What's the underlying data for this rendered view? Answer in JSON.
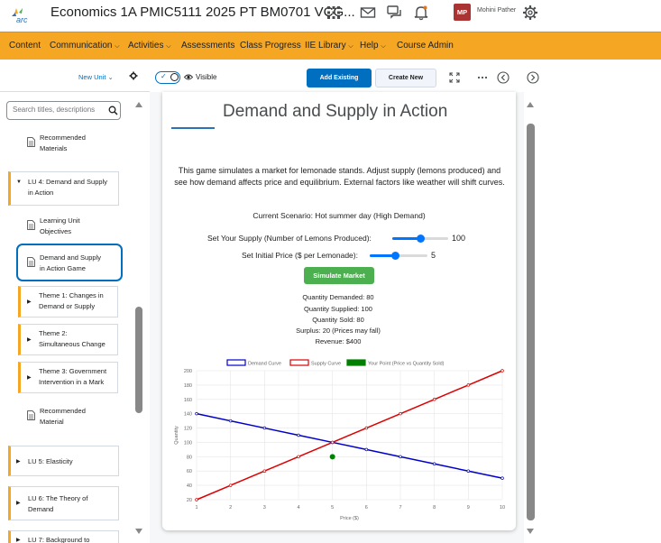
{
  "topbar": {
    "course_title": "Economics 1A PMIC5111 2025 PT BM0701 VCG...",
    "avatar_initials": "MP",
    "user_name": "Mohini Pather"
  },
  "nav": [
    "Content",
    "Communication",
    "Activities",
    "Assessments",
    "Class Progress",
    "IIE Library",
    "Help",
    "Course Admin"
  ],
  "sidebar": {
    "new_unit": "New Unit",
    "search_placeholder": "Search titles, descriptions",
    "items": {
      "rec1": "Recommended\nMaterials",
      "lu4": "LU 4: Demand and Supply\nin Action",
      "luo": "Learning Unit\nObjectives",
      "dsag": "Demand and Supply\nin Action Game",
      "t1": "Theme 1: Changes in\nDemand or Supply",
      "t2": "Theme 2:\nSimultaneous Change",
      "t3": "Theme 3: Government\nIntervention in a Mark",
      "rec2": "Recommended\nMaterial",
      "lu5": "LU 5: Elasticity",
      "lu6": "LU 6: The Theory of\nDemand",
      "lu7": "LU 7: Background to"
    }
  },
  "toolbar": {
    "visible": "Visible",
    "add_existing": "Add Existing",
    "create_new": "Create New"
  },
  "game": {
    "title": "Demand and Supply in Action",
    "description": "This game simulates a market for lemonade stands. Adjust supply (lemons produced) and see how demand affects price and equilibrium. External factors like weather will shift curves.",
    "scenario": "Current Scenario: Hot summer day (High Demand)",
    "supply_label": "Set Your Supply (Number of Lemons Produced):",
    "supply_value": "100",
    "supply_fraction": 0.5,
    "price_label": "Set Initial Price ($ per Lemonade):",
    "price_value": "5",
    "price_fraction": 0.44,
    "simulate": "Simulate Market",
    "results": [
      "Quantity Demanded: 80",
      "Quantity Supplied: 100",
      "Quantity Sold: 80",
      "Surplus: 20 (Prices may fall)",
      "Revenue: $400"
    ]
  },
  "colors": {
    "accent": "#006fbf",
    "nav_bg": "#f5a623",
    "demand": "#0000cc",
    "supply": "#dd0000",
    "point": "#008000",
    "sim_button": "#4caf50"
  },
  "chart_data": {
    "type": "line",
    "x": [
      1,
      2,
      3,
      4,
      5,
      6,
      7,
      8,
      9,
      10
    ],
    "series": [
      {
        "name": "Demand Curve",
        "values": [
          140,
          130,
          120,
          110,
          100,
          90,
          80,
          70,
          60,
          50
        ]
      },
      {
        "name": "Supply Curve",
        "values": [
          20,
          40,
          60,
          80,
          100,
          120,
          140,
          160,
          180,
          200
        ]
      }
    ],
    "point": {
      "name": "Your Point (Price vs Quantity Sold)",
      "x": 5,
      "y": 80
    },
    "xlabel": "Price ($)",
    "ylabel": "Quantity",
    "xlim": [
      1,
      10
    ],
    "ylim": [
      20,
      200
    ],
    "yticks": [
      20,
      40,
      60,
      80,
      100,
      120,
      140,
      160,
      180,
      200
    ],
    "xticks": [
      1,
      2,
      3,
      4,
      5,
      6,
      7,
      8,
      9,
      10
    ],
    "grid": true,
    "legend": "top"
  }
}
